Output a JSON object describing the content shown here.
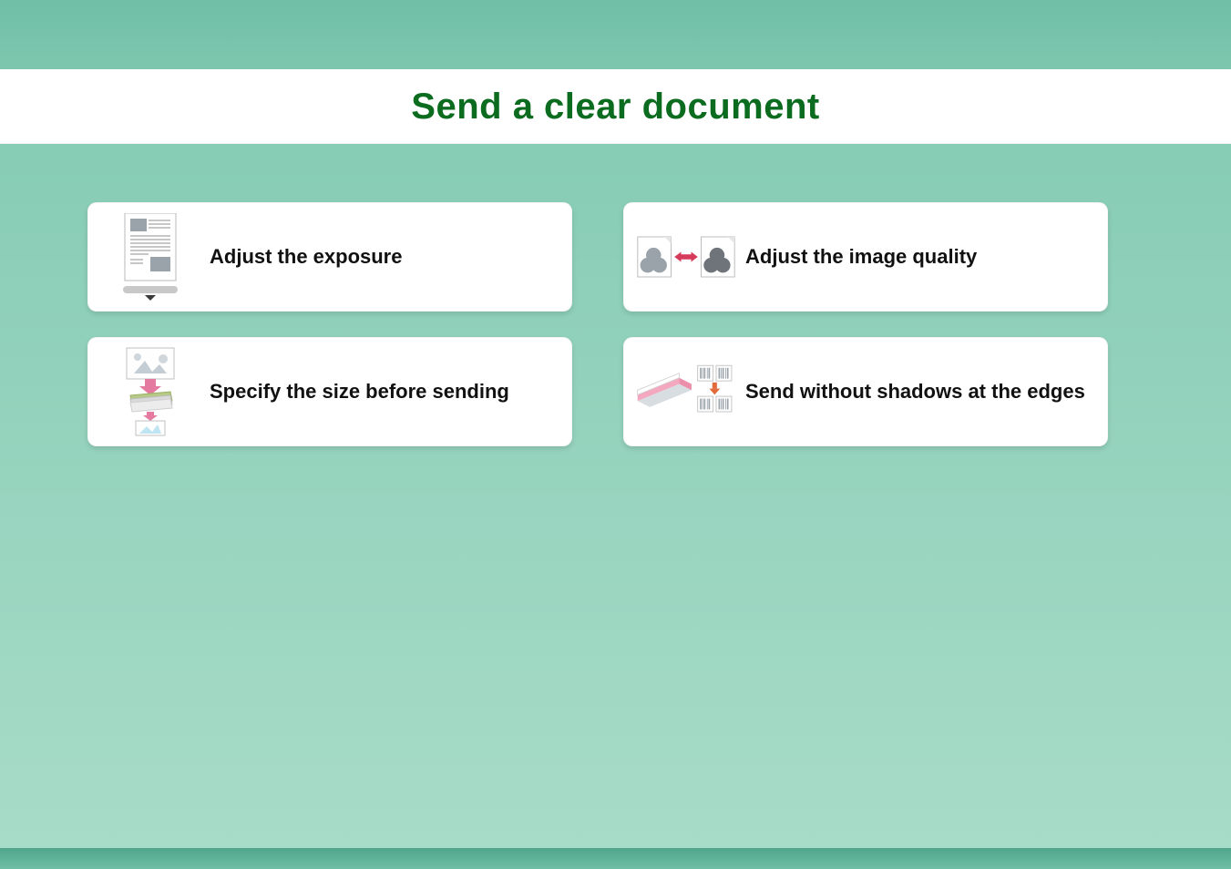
{
  "page": {
    "title": "Send a clear document"
  },
  "cards": {
    "exposure": {
      "label": "Adjust the exposure"
    },
    "quality": {
      "label": "Adjust the image quality"
    },
    "size": {
      "label": "Specify the size before sending"
    },
    "edges": {
      "label": "Send without shadows at the edges"
    }
  }
}
